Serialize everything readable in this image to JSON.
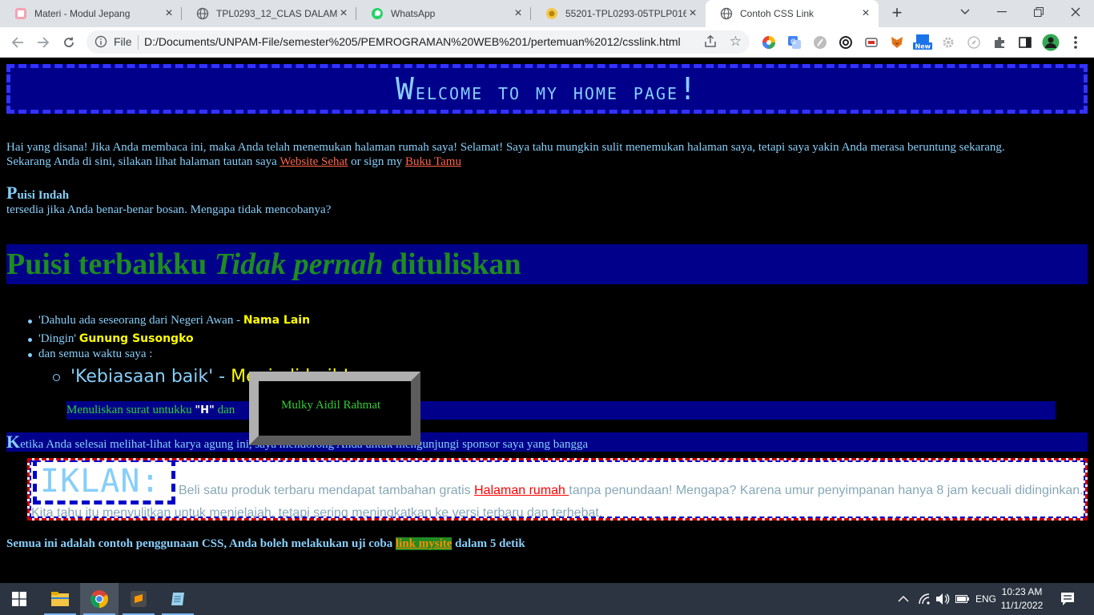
{
  "browser": {
    "tabs": [
      {
        "title": "Materi - Modul Jepang",
        "icon": "pink-book-icon"
      },
      {
        "title": "TPL0293_12_CLAS DALAM C...",
        "icon": "globe-icon"
      },
      {
        "title": "WhatsApp",
        "icon": "whatsapp-icon"
      },
      {
        "title": "55201-TPL0293-05TPLP016-2...",
        "icon": "yellow-circle-icon"
      },
      {
        "title": "Contoh CSS Link",
        "icon": "globe-icon",
        "active": true
      }
    ],
    "file_label": "File",
    "url": "D:/Documents/UNPAM-File/semester%205/PEMROGRAMAN%20WEB%201/pertemuan%2012/csslink.html"
  },
  "page": {
    "welcome": {
      "w": "W",
      "rest": "elcome to my home page",
      "bang": "!"
    },
    "intro": {
      "line1": "Hai yang disana! Jika Anda membaca ini, maka Anda telah menemukan halaman rumah saya! Selamat! Saya tahu mungkin sulit menemukan halaman saya, tetapi saya yakin Anda merasa beruntung sekarang.",
      "line2_pre": "Sekarang Anda di sini, silakan lihat halaman tautan saya ",
      "link1": "Website Sehat",
      "line2_mid": " or sign my ",
      "link2": "Buku Tamu"
    },
    "puisi": {
      "cap": "P",
      "rest": "uisi Indah",
      "desc": "tersedia jika Anda benar-benar bosan. Mengapa tidak mencobanya?"
    },
    "poem_band": {
      "pre": "Puisi terbaikku ",
      "italic": "Tidak pernah",
      "post": " dituliskan"
    },
    "list": {
      "item1_text": "'Dahulu ada seseorang dari Negeri Awan - ",
      "item1_bold": "Nama Lain",
      "item2_text": "'Dingin' ",
      "item2_bold": "Gunung Susongko",
      "item3_text": "dan semua waktu saya :",
      "sub_text": "'Kebiasaan baik' - ",
      "sub_yellow": "Menjadi baik!"
    },
    "letter": {
      "pre": "Menuliskan surat untukku ",
      "q": "\"H\"",
      "mid": " dan"
    },
    "popup_name": "Mulky Aidil Rahmat",
    "ketika": {
      "cap": "K",
      "rest": "etika Anda selesai melihat-lihat karya agung ini, saya mendorong Anda untuk mengunjungi sponsor saya yang bangga"
    },
    "ad": {
      "title": "IKLAN:",
      "text_pre": "Beli satu produk terbaru mendapat tambahan gratis ",
      "link": "Halaman rumah ",
      "text_post": "tanpa penundaan! Mengapa? Karena umur penyimpanan hanya 8 jam kecuali didinginkan.",
      "line2": "Kita tahu itu menyulitkan untuk menjelajah, tetapi sering meningkatkan ke versi terbaru dan terhebat."
    },
    "footer": {
      "pre": "Semua ini adalah contoh penggunaan CSS, Anda boleh melakukan uji coba ",
      "link": "link mysite",
      "post": " dalam 5 detik"
    }
  },
  "taskbar": {
    "lang": "ENG",
    "time": "10:23 AM",
    "date": "11/1/2022",
    "apps": [
      "windows-start-icon",
      "file-explorer-icon",
      "chrome-icon",
      "sublime-text-icon",
      "notepad-icon"
    ]
  }
}
